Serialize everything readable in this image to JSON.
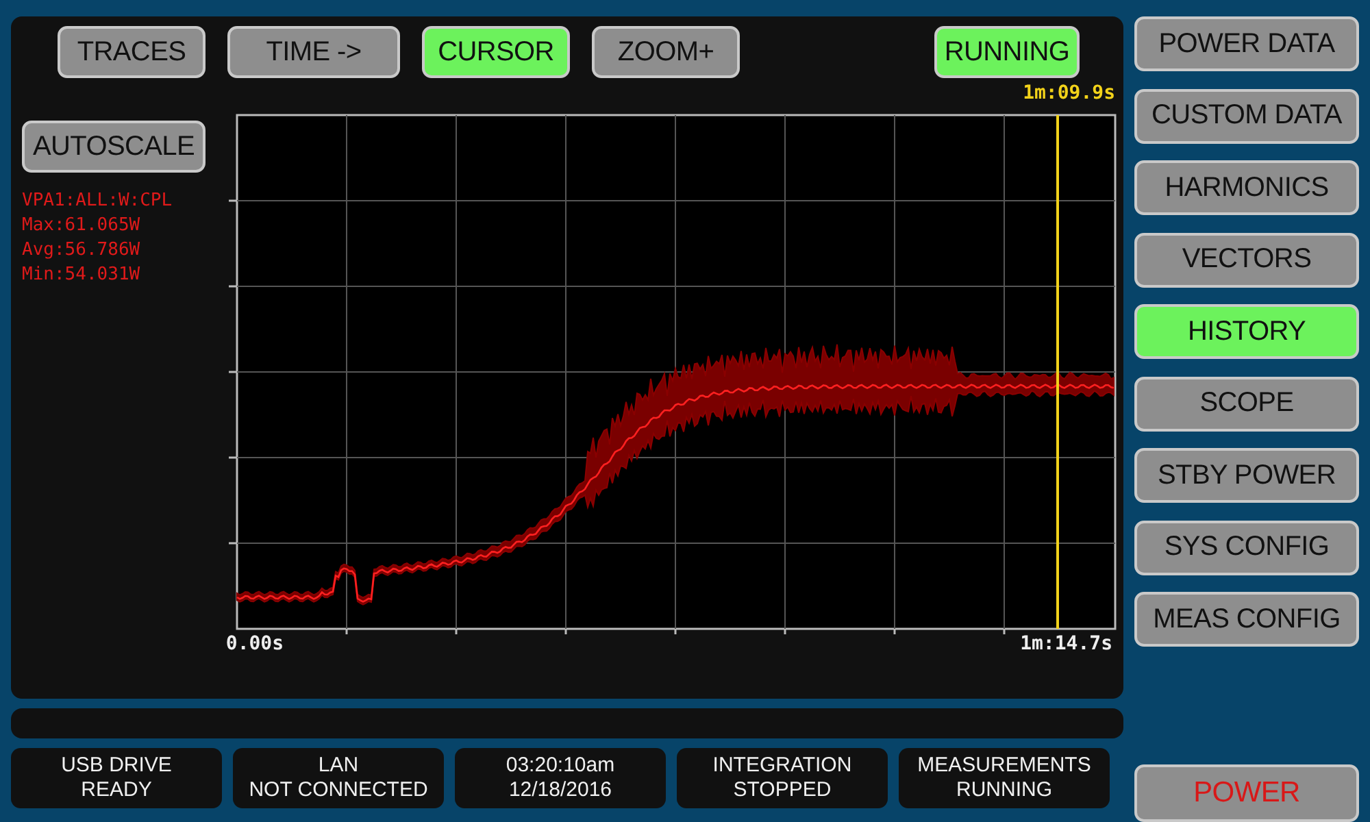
{
  "toolbar": [
    {
      "label": "TRACES",
      "selected": false
    },
    {
      "label": "TIME ->",
      "selected": false
    },
    {
      "label": "CURSOR",
      "selected": true
    },
    {
      "label": "ZOOM+",
      "selected": false
    }
  ],
  "run_state": {
    "label": "RUNNING",
    "on": true
  },
  "cursor": {
    "reading": "1m:09.9s"
  },
  "autoscale": {
    "label": "AUTOSCALE"
  },
  "trace_info": [
    "VPA1:ALL:W:CPL",
    "Max:61.065W",
    "Avg:56.786W",
    "Min:54.031W"
  ],
  "plot": {
    "x_start": "0.00s",
    "x_end": "1m:14.7s"
  },
  "nav": [
    {
      "label": "POWER DATA",
      "selected": false
    },
    {
      "label": "CUSTOM DATA",
      "selected": false
    },
    {
      "label": "HARMONICS",
      "selected": false
    },
    {
      "label": "VECTORS",
      "selected": false
    },
    {
      "label": "HISTORY",
      "selected": true
    },
    {
      "label": "SCOPE",
      "selected": false
    },
    {
      "label": "STBY POWER",
      "selected": false
    },
    {
      "label": "SYS CONFIG",
      "selected": false
    },
    {
      "label": "MEAS CONFIG",
      "selected": false
    }
  ],
  "status": [
    {
      "line_1": "USB DRIVE",
      "line_2": "READY"
    },
    {
      "line_1": "LAN",
      "line_2": "NOT CONNECTED"
    },
    {
      "line_1": "03:20:10am",
      "line_2": "12/18/2016"
    },
    {
      "line_1": "INTEGRATION",
      "line_2": "STOPPED"
    },
    {
      "line_1": "MEASUREMENTS",
      "line_2": "RUNNING"
    }
  ],
  "power_button": {
    "label": "POWER"
  }
}
